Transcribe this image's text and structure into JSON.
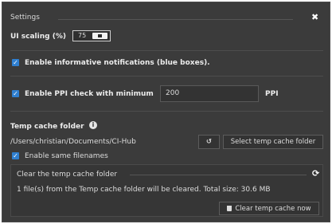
{
  "dialog": {
    "title": "Settings",
    "close_icon": "close-icon"
  },
  "ui_scaling": {
    "label": "UI scaling (%)",
    "value": "75"
  },
  "notifications": {
    "checked": true,
    "label": "Enable informative notifications (blue boxes)."
  },
  "ppi_check": {
    "checked": true,
    "label": "Enable PPI check with minimum",
    "value": "200",
    "unit": "PPI"
  },
  "temp_cache": {
    "label": "Temp cache folder",
    "info_icon": "info-icon",
    "path": "/Users/christian/Documents/CI-Hub",
    "reset_icon": "reset-icon",
    "select_button": "Select temp cache folder",
    "same_filenames_checked": true,
    "same_filenames_label": "Enable same filenames"
  },
  "clear_cache": {
    "title": "Clear the temp cache folder",
    "refresh_icon": "refresh-icon",
    "message": "1 file(s) from the Temp cache folder will be cleared. Total size: 30.6 MB",
    "button_label": "Clear temp cache now",
    "trash_icon": "trash-icon"
  },
  "colors": {
    "background": "#3b3b3b",
    "accent": "#2f7fd0",
    "text": "#e6e6e6"
  }
}
